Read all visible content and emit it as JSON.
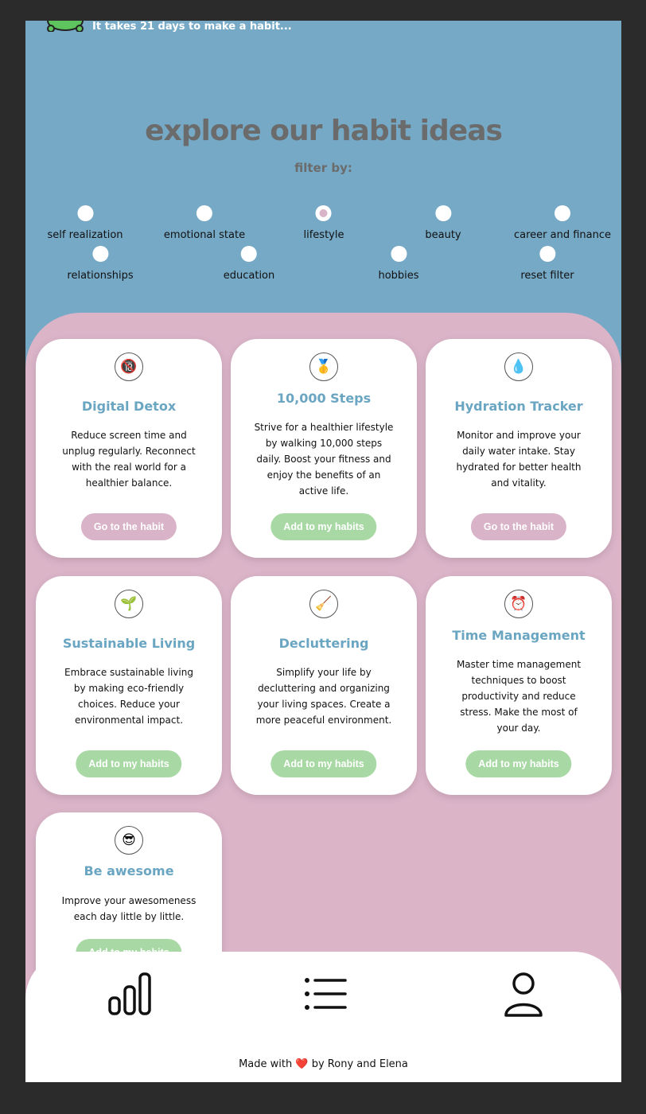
{
  "header": {
    "tagline": "It takes 21 days to make a habit..."
  },
  "explore": {
    "title": "explore our habit ideas",
    "filter_label": "filter by:"
  },
  "filters": [
    {
      "label": "self realization",
      "selected": false
    },
    {
      "label": "emotional state",
      "selected": false
    },
    {
      "label": "lifestyle",
      "selected": true
    },
    {
      "label": "beauty",
      "selected": false
    },
    {
      "label": "career and finance",
      "selected": false
    },
    {
      "label": "relationships",
      "selected": false
    },
    {
      "label": "education",
      "selected": false
    },
    {
      "label": "hobbies",
      "selected": false
    },
    {
      "label": "reset filter",
      "selected": false
    }
  ],
  "cards": [
    {
      "icon": "🔞",
      "icon_name": "no-phone-icon",
      "title": "Digital Detox",
      "description": "Reduce screen time and unplug regularly. Reconnect with the real world for a healthier balance.",
      "button": "Go to the habit",
      "button_style": "pink"
    },
    {
      "icon": "🥇",
      "icon_name": "medal-icon",
      "title": "10,000 Steps",
      "description": "Strive for a healthier lifestyle by walking 10,000 steps daily. Boost your fitness and enjoy the benefits of an active life.",
      "button": "Add to my habits",
      "button_style": "green"
    },
    {
      "icon": "💧",
      "icon_name": "water-drop-icon",
      "title": "Hydration Tracker",
      "description": "Monitor and improve your daily water intake. Stay hydrated for better health and vitality.",
      "button": "Go to the habit",
      "button_style": "pink"
    },
    {
      "icon": "🌱",
      "icon_name": "seedling-icon",
      "title": "Sustainable Living",
      "description": "Embrace sustainable living by making eco-friendly choices. Reduce your environmental impact.",
      "button": "Add to my habits",
      "button_style": "green"
    },
    {
      "icon": "🧹",
      "icon_name": "broom-icon",
      "title": "Decluttering",
      "description": "Simplify your life by decluttering and organizing your living spaces. Create a more peaceful environment.",
      "button": "Add to my habits",
      "button_style": "green"
    },
    {
      "icon": "⏰",
      "icon_name": "alarm-clock-icon",
      "title": "Time Management",
      "description": "Master time management techniques to boost productivity and reduce stress. Make the most of your day.",
      "button": "Add to my habits",
      "button_style": "green"
    },
    {
      "icon": "😎",
      "icon_name": "sunglasses-face-icon",
      "title": "Be awesome",
      "description": "Improve your awesomeness each day little by little.",
      "button": "Add to my habits",
      "button_style": "green"
    }
  ],
  "bottom_nav": {
    "items": [
      {
        "icon_name": "stats-bar-chart-icon"
      },
      {
        "icon_name": "list-icon"
      },
      {
        "icon_name": "profile-icon"
      }
    ]
  },
  "footer": {
    "text_before": "Made with",
    "heart": "❤️",
    "text_after": "by Rony and Elena"
  },
  "colors": {
    "top_background": "#76a9c6",
    "content_background": "#dbb4c8",
    "accent_pink": "#d9b3c8",
    "accent_green": "#a8d9a4",
    "title_blue": "#6aa5c2"
  }
}
